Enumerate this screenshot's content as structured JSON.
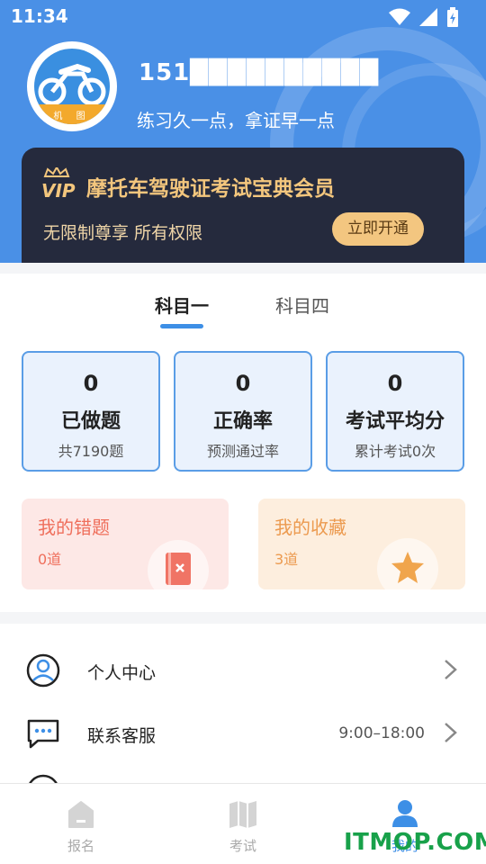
{
  "status_bar": {
    "time": "11:34",
    "icons": [
      "wifi-icon",
      "signal-icon",
      "battery-charging-icon"
    ]
  },
  "profile": {
    "avatar_badge_text": "机 图",
    "username": "151██████████",
    "slogan": "练习久一点，拿证早一点"
  },
  "vip": {
    "logo_text": "VIP",
    "title": "摩托车驾驶证考试宝典会员",
    "subtitle": "无限制尊享  所有权限",
    "button_label": "立即开通"
  },
  "subject_tabs": [
    {
      "label": "科目一",
      "active": true
    },
    {
      "label": "科目四",
      "active": false
    }
  ],
  "stats": [
    {
      "value": "0",
      "label": "已做题",
      "sub": "共7190题"
    },
    {
      "value": "0",
      "label": "正确率",
      "sub": "预测通过率"
    },
    {
      "value": "0",
      "label": "考试平均分",
      "sub": "累计考试0次"
    }
  ],
  "quick_cards": {
    "wrong": {
      "title": "我的错题",
      "count": "0道"
    },
    "collect": {
      "title": "我的收藏",
      "count": "3道"
    }
  },
  "menu": [
    {
      "label": "个人中心",
      "right": ""
    },
    {
      "label": "联系客服",
      "right": "9:00–18:00"
    }
  ],
  "bottom_tabs": [
    {
      "label": "报名",
      "active": false
    },
    {
      "label": "考试",
      "active": false
    },
    {
      "label": "我的",
      "active": true
    }
  ],
  "watermark": "ITMOP.COM",
  "colors": {
    "primary": "#4a90e6",
    "vip_dark": "#252a3d",
    "gold": "#f3c67d",
    "wrong_red": "#ef6f5c",
    "collect_orange": "#ec9a4f"
  }
}
